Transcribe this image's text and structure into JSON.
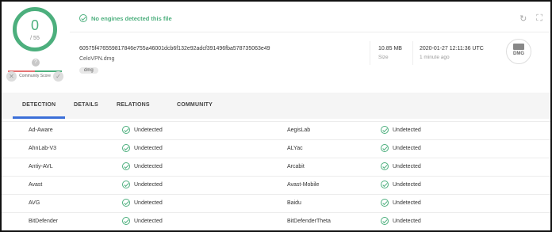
{
  "score": {
    "detections": "0",
    "total": "/ 55"
  },
  "community": {
    "label": "Community Score",
    "center": "?",
    "down": "✕",
    "up": "✓"
  },
  "status": {
    "message": "No engines detected this file"
  },
  "file": {
    "hash": "60575f476559817846e755a46001dcb6f132e92adcf391496fba578735063e49",
    "name": "CeloVPN.dmg",
    "tag": "dmg",
    "size": "10.85 MB",
    "size_label": "Size",
    "date": "2020-01-27 12:11:36 UTC",
    "date_ago": "1 minute ago",
    "type_icon_text": "DMG"
  },
  "tabs": [
    "DETECTION",
    "DETAILS",
    "RELATIONS",
    "COMMUNITY"
  ],
  "active_tab": "DETECTION",
  "results": [
    {
      "left": {
        "engine": "Ad-Aware",
        "result": "Undetected"
      },
      "right": {
        "engine": "AegisLab",
        "result": "Undetected"
      }
    },
    {
      "left": {
        "engine": "AhnLab-V3",
        "result": "Undetected"
      },
      "right": {
        "engine": "ALYac",
        "result": "Undetected"
      }
    },
    {
      "left": {
        "engine": "Antiy-AVL",
        "result": "Undetected"
      },
      "right": {
        "engine": "Arcabit",
        "result": "Undetected"
      }
    },
    {
      "left": {
        "engine": "Avast",
        "result": "Undetected"
      },
      "right": {
        "engine": "Avast-Mobile",
        "result": "Undetected"
      }
    },
    {
      "left": {
        "engine": "AVG",
        "result": "Undetected"
      },
      "right": {
        "engine": "Baidu",
        "result": "Undetected"
      }
    },
    {
      "left": {
        "engine": "BitDefender",
        "result": "Undetected"
      },
      "right": {
        "engine": "BitDefenderTheta",
        "result": "Undetected"
      }
    }
  ],
  "colors": {
    "clean": "#4caf7d",
    "accent": "#3b6fd8",
    "malicious": "#e57373"
  }
}
